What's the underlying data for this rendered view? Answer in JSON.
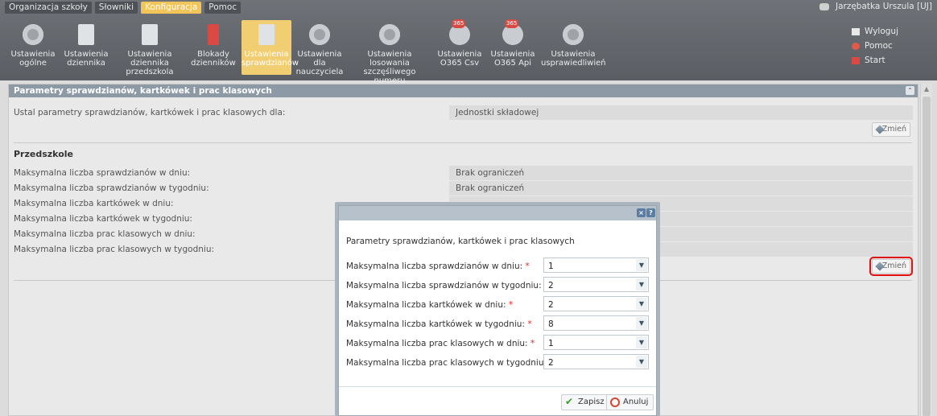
{
  "menu": [
    "Organizacja szkoły",
    "Słowniki",
    "Konfiguracja",
    "Pomoc"
  ],
  "menu_active_index": 2,
  "user": {
    "name": "Jarzębatka Urszula [UJ]"
  },
  "toolbar": [
    {
      "label": "Ustawienia ogólne",
      "icon": "gear-icon"
    },
    {
      "label": "Ustawienia dziennika",
      "icon": "journal-icon"
    },
    {
      "label": "Ustawienia dziennika przedszkola",
      "icon": "journal-icon"
    },
    {
      "label": "Blokady dzienników",
      "icon": "lock-journal-icon"
    },
    {
      "label": "Ustawienia sprawdzianów",
      "icon": "test-sheet-icon",
      "active": true
    },
    {
      "label": "Ustawienia dla nauczyciela",
      "icon": "teacher-settings-icon"
    },
    {
      "label": "Ustawienia losowania szczęśliwego numeru",
      "icon": "lucky-number-icon"
    },
    {
      "label": "Ustawienia O365 Csv",
      "icon": "o365-icon"
    },
    {
      "label": "Ustawienia O365 Api",
      "icon": "o365-icon"
    },
    {
      "label": "Ustawienia usprawiedliwień",
      "icon": "excuse-settings-icon"
    }
  ],
  "sidelinks": [
    "Wyloguj",
    "Pomoc",
    "Start"
  ],
  "panel": {
    "title": "Parametry sprawdzianów, kartkówek i prac klasowych",
    "setting_label": "Ustal parametry sprawdzianów, kartkówek i prac klasowych dla:",
    "setting_value": "Jednostki składowej",
    "change_label": "Zmień",
    "section": "Przedszkole",
    "rows": [
      {
        "label": "Maksymalna liczba sprawdzianów w dniu:",
        "value": "Brak ograniczeń"
      },
      {
        "label": "Maksymalna liczba sprawdzianów w tygodniu:",
        "value": "Brak ograniczeń"
      },
      {
        "label": "Maksymalna liczba kartkówek w dniu:",
        "value": ""
      },
      {
        "label": "Maksymalna liczba kartkówek w tygodniu:",
        "value": ""
      },
      {
        "label": "Maksymalna liczba prac klasowych w dniu:",
        "value": ""
      },
      {
        "label": "Maksymalna liczba prac klasowych w tygodniu:",
        "value": ""
      }
    ]
  },
  "dialog": {
    "close_symbol": "×",
    "help_symbol": "?",
    "heading": "Parametry sprawdzianów, kartkówek i prac klasowych",
    "fields": [
      {
        "label": "Maksymalna liczba sprawdzianów w dniu:",
        "value": "1"
      },
      {
        "label": "Maksymalna liczba sprawdzianów w tygodniu:",
        "value": "2"
      },
      {
        "label": "Maksymalna liczba kartkówek w dniu:",
        "value": "2"
      },
      {
        "label": "Maksymalna liczba kartkówek w tygodniu:",
        "value": "8"
      },
      {
        "label": "Maksymalna liczba prac klasowych w dniu:",
        "value": "1"
      },
      {
        "label": "Maksymalna liczba prac klasowych w tygodniu:",
        "value": "2"
      }
    ],
    "required_mark": "*",
    "save_label": "Zapisz",
    "cancel_label": "Anuluj"
  },
  "colors": {
    "accent": "#f1c55a",
    "highlight": "#e01010",
    "header": "#8d9aa6"
  }
}
